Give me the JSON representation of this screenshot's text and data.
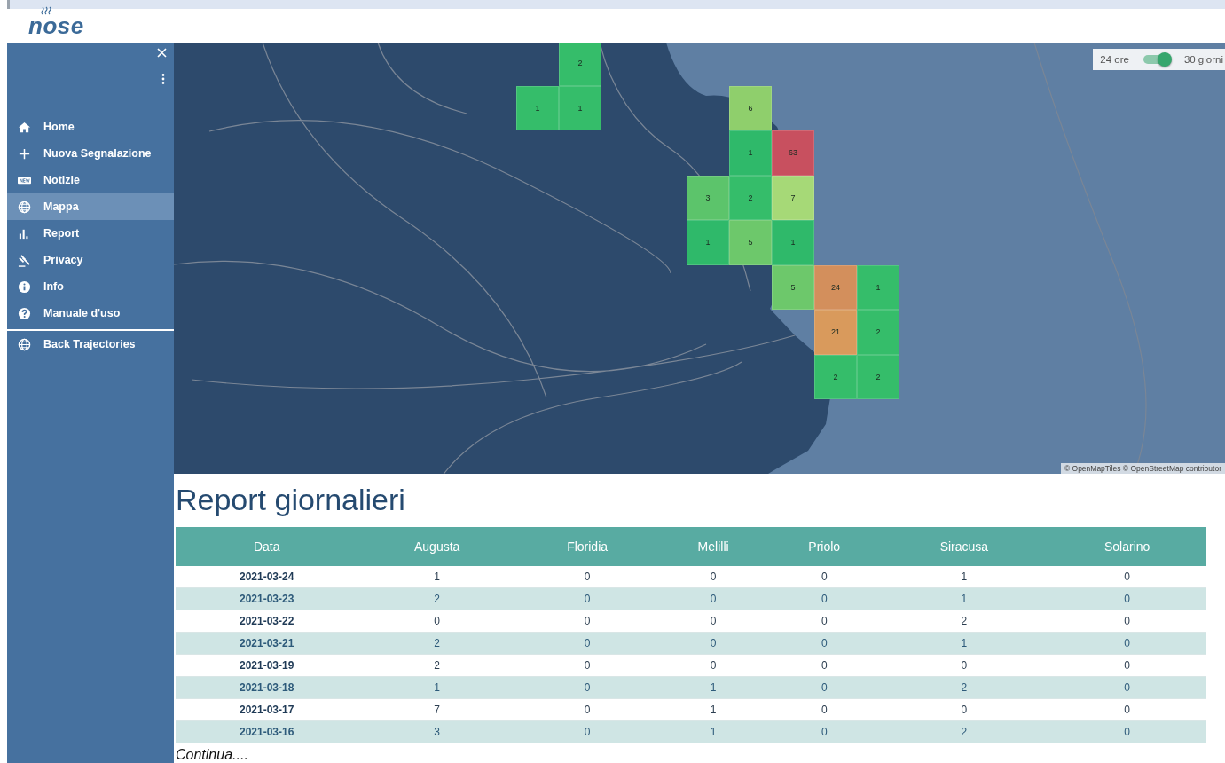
{
  "header": {
    "logo": "nose"
  },
  "sidebar": {
    "items": [
      {
        "label": "Home",
        "kind": "home",
        "selected": false
      },
      {
        "label": "Nuova Segnalazione",
        "kind": "plus",
        "selected": false
      },
      {
        "label": "Notizie",
        "kind": "new",
        "selected": false
      },
      {
        "label": "Mappa",
        "kind": "globe",
        "selected": true
      },
      {
        "label": "Report",
        "kind": "bars",
        "selected": false
      },
      {
        "label": "Privacy",
        "kind": "gavel",
        "selected": false
      },
      {
        "label": "Info",
        "kind": "info",
        "selected": false
      },
      {
        "label": "Manuale d'uso",
        "kind": "help",
        "selected": false
      }
    ],
    "extra_items": [
      {
        "label": "Back Trajectories",
        "kind": "globe",
        "selected": false
      }
    ]
  },
  "map": {
    "toggle": {
      "left_label": "24 ore",
      "right_label": "30 giorni",
      "on": true
    },
    "attribution": "© OpenMapTiles © OpenStreetMap contributor",
    "heat_rows": [
      [
        null,
        {
          "count": "2",
          "color": "#35bd6a"
        }
      ],
      [
        {
          "count": "1",
          "color": "#35bd6a"
        },
        {
          "count": "1",
          "color": "#35bd6a"
        },
        null,
        null,
        null,
        {
          "count": "6",
          "color": "#8fcf6c"
        }
      ],
      [
        null,
        null,
        null,
        null,
        null,
        {
          "count": "1",
          "color": "#2fb96a"
        },
        {
          "count": "63",
          "color": "#c8505f"
        }
      ],
      [
        null,
        null,
        null,
        null,
        {
          "count": "3",
          "color": "#5cc46b"
        },
        {
          "count": "2",
          "color": "#35bd6a"
        },
        {
          "count": "7",
          "color": "#a6d977"
        }
      ],
      [
        null,
        null,
        null,
        null,
        {
          "count": "1",
          "color": "#2fb96a"
        },
        {
          "count": "5",
          "color": "#6dc86b"
        },
        {
          "count": "1",
          "color": "#2fb96a"
        }
      ],
      [
        null,
        null,
        null,
        null,
        null,
        null,
        {
          "count": "5",
          "color": "#6dc86b"
        },
        {
          "count": "24",
          "color": "#d38f5c"
        },
        {
          "count": "1",
          "color": "#35bd6a"
        }
      ],
      [
        null,
        null,
        null,
        null,
        null,
        null,
        null,
        {
          "count": "21",
          "color": "#d99a5c"
        },
        {
          "count": "2",
          "color": "#35bd6a"
        }
      ],
      [
        null,
        null,
        null,
        null,
        null,
        null,
        null,
        {
          "count": "2",
          "color": "#35bd6a"
        },
        {
          "count": "2",
          "color": "#35bd6a"
        }
      ]
    ]
  },
  "report": {
    "title": "Report giornalieri",
    "columns": [
      "Data",
      "Augusta",
      "Floridia",
      "Melilli",
      "Priolo",
      "Siracusa",
      "Solarino"
    ],
    "rows": [
      [
        "2021-03-24",
        "1",
        "0",
        "0",
        "0",
        "1",
        "0"
      ],
      [
        "2021-03-23",
        "2",
        "0",
        "0",
        "0",
        "1",
        "0"
      ],
      [
        "2021-03-22",
        "0",
        "0",
        "0",
        "0",
        "2",
        "0"
      ],
      [
        "2021-03-21",
        "2",
        "0",
        "0",
        "0",
        "1",
        "0"
      ],
      [
        "2021-03-19",
        "2",
        "0",
        "0",
        "0",
        "0",
        "0"
      ],
      [
        "2021-03-18",
        "1",
        "0",
        "1",
        "0",
        "2",
        "0"
      ],
      [
        "2021-03-17",
        "7",
        "0",
        "1",
        "0",
        "0",
        "0"
      ],
      [
        "2021-03-16",
        "3",
        "0",
        "1",
        "0",
        "2",
        "0"
      ]
    ],
    "more_link": "Continua...."
  }
}
